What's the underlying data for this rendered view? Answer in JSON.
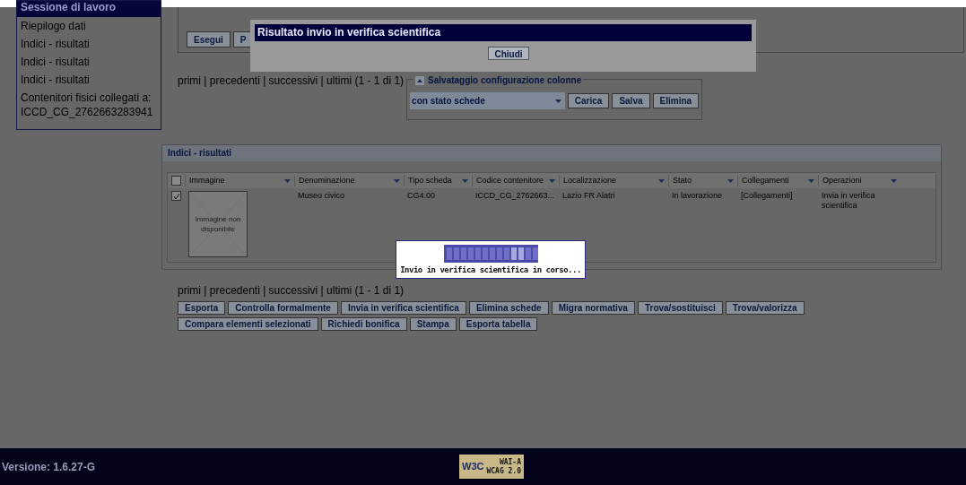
{
  "sidebar": {
    "header": "Sessione di lavoro",
    "items": [
      {
        "label": "Riepilogo dati"
      },
      {
        "label": "Indici - risultati"
      },
      {
        "label": "Indici - risultati"
      },
      {
        "label": "Indici - risultati"
      },
      {
        "label": "Contenitori fisici collegati a: ICCD_CG_2762663283941"
      }
    ]
  },
  "search_panel": {
    "buttons": [
      "Esegui",
      "P"
    ]
  },
  "dialog": {
    "title": "Risultato invio in verifica scientifica",
    "button": "Chiudi"
  },
  "pagination_top": "primi | precedenti | successivi | ultimi (1 - 1 di 1)",
  "column_config": {
    "legend": "Salvataggio configurazione colonne",
    "select_value": "con stato schede",
    "buttons": [
      "Carica",
      "Salva",
      "Elimina"
    ]
  },
  "table": {
    "title": "Indici - risultati",
    "header_checked": false,
    "columns": [
      "Immagine",
      "Denominazione",
      "Tipo scheda",
      "Codice contenitore",
      "Localizzazione",
      "Stato",
      "Collegamenti",
      "Operazioni"
    ],
    "rows": [
      {
        "selected": true,
        "cells": [
          "Immagine non disponibile",
          "Museo civico",
          "CG4.00",
          "ICCD_CG_2762663...",
          "Lazio FR Alatri",
          "In lavorazione",
          "[Collegamenti]",
          "Invia in verifica scientifica"
        ]
      }
    ]
  },
  "progress": {
    "text": "Invio in verifica scientifica in corso..."
  },
  "pagination_bottom": "primi | precedenti | successivi | ultimi (1 - 1 di 1)",
  "actions": [
    [
      "Esporta",
      "Controlla formalmente",
      "Invia in verifica scientifica",
      "Elimina schede",
      "Migra normativa",
      "Trova/sostituisci",
      "Trova/valorizza"
    ],
    [
      "Compara elementi selezionati",
      "Richiedi bonifica",
      "Stampa",
      "Esporta tabella"
    ]
  ],
  "footer": {
    "version": "Versione: 1.6.27-G",
    "badge_left": "W3C",
    "badge_top": "WAI-A",
    "badge_bottom": "WCAG 2.0"
  }
}
